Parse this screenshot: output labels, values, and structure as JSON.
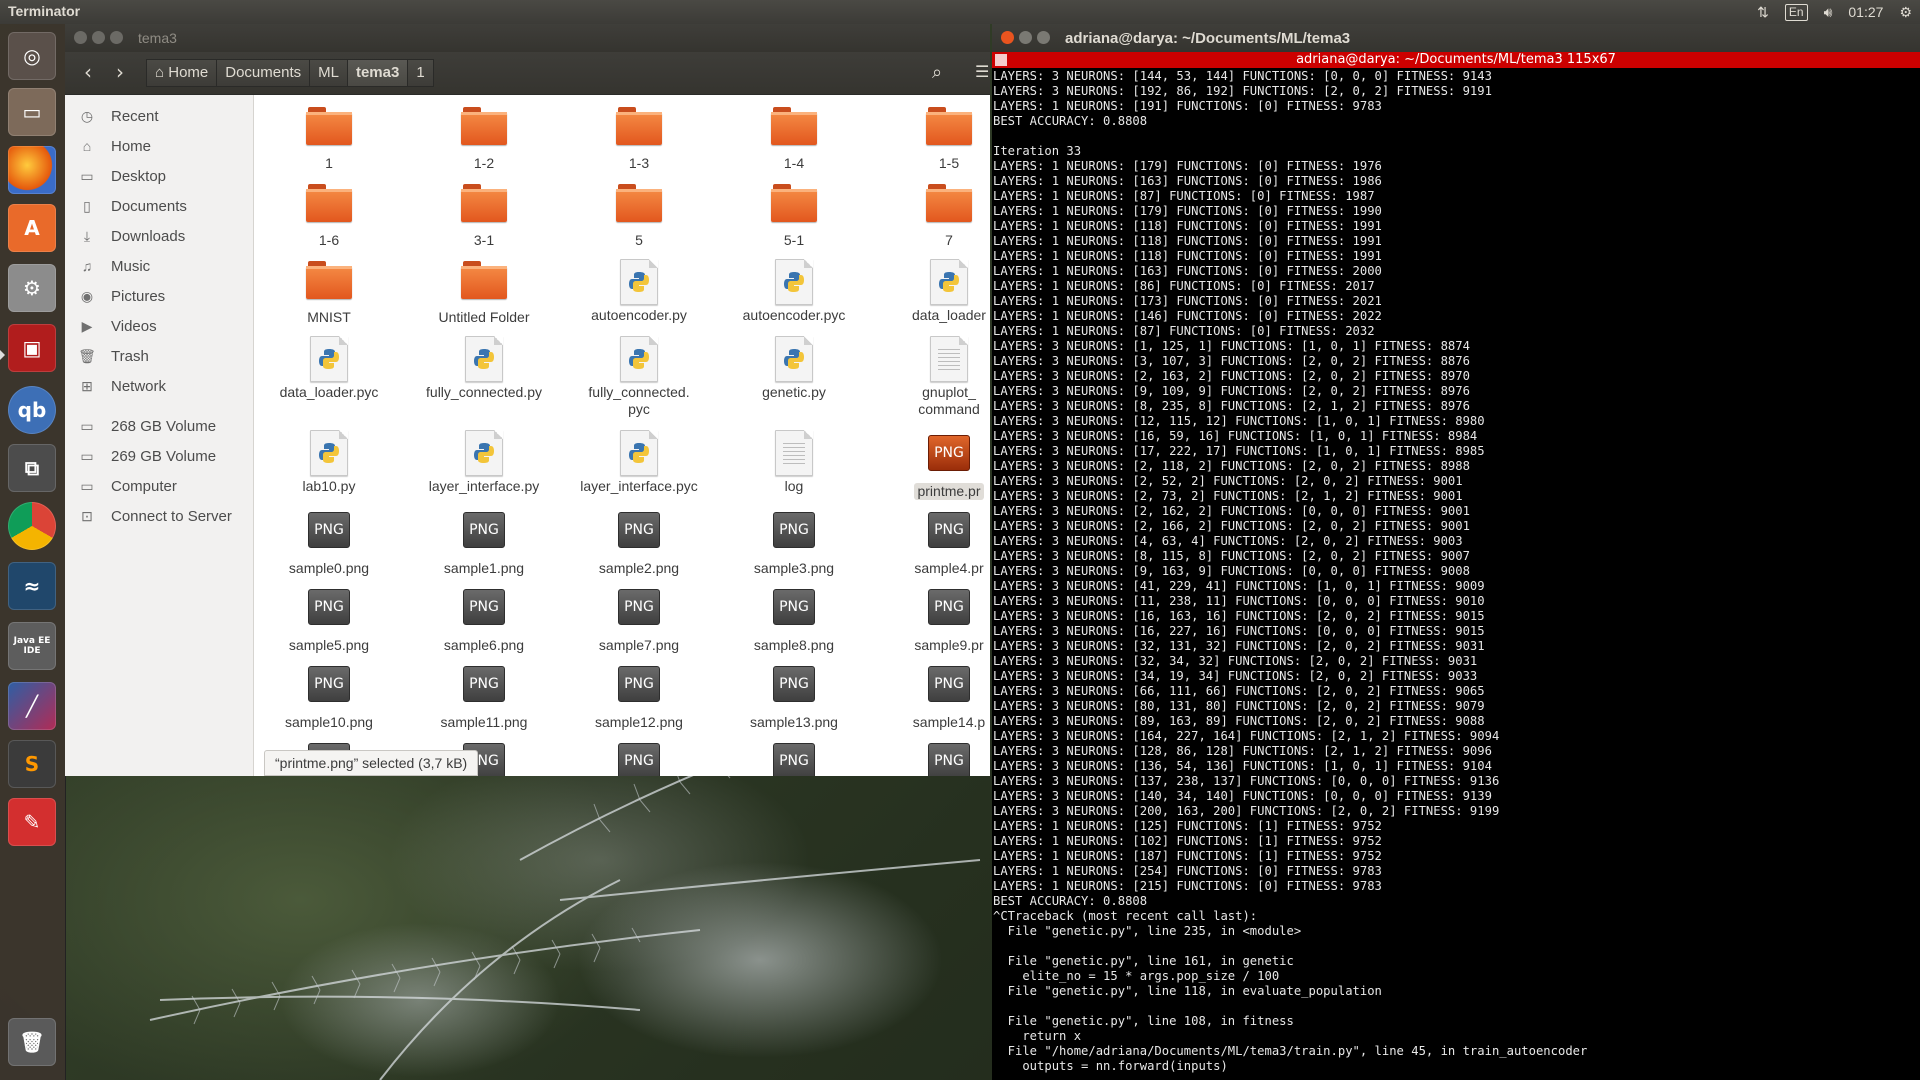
{
  "top_panel": {
    "app_title": "Terminator",
    "keyboard_layout": "En",
    "clock": "01:27",
    "icons": [
      "network-arrows-icon",
      "volume-icon",
      "settings-gear-icon"
    ]
  },
  "launcher": {
    "items": [
      {
        "name": "dash-icon"
      },
      {
        "name": "files-icon"
      },
      {
        "name": "firefox-icon"
      },
      {
        "name": "software-center-icon"
      },
      {
        "name": "system-settings-icon"
      },
      {
        "name": "terminator-icon"
      },
      {
        "name": "qbittorrent-icon",
        "label": "qb"
      },
      {
        "name": "workspace-switcher-icon"
      },
      {
        "name": "chrome-icon"
      },
      {
        "name": "mysql-workbench-icon"
      },
      {
        "name": "java-ee-ide-icon",
        "label": "Java EE IDE"
      },
      {
        "name": "pycharm-icon"
      },
      {
        "name": "sublime-text-icon",
        "label": "S"
      },
      {
        "name": "evince-icon"
      },
      {
        "name": "trash-icon"
      }
    ]
  },
  "file_manager": {
    "window_title": "tema3",
    "breadcrumbs": [
      {
        "label": "Home",
        "icon": "home-icon"
      },
      {
        "label": "Documents"
      },
      {
        "label": "ML"
      },
      {
        "label": "tema3",
        "active": true
      },
      {
        "label": "1"
      }
    ],
    "sidebar": [
      {
        "label": "Recent",
        "icon": "clock-icon"
      },
      {
        "label": "Home",
        "icon": "home-icon"
      },
      {
        "label": "Desktop",
        "icon": "folder-icon"
      },
      {
        "label": "Documents",
        "icon": "document-icon"
      },
      {
        "label": "Downloads",
        "icon": "download-icon"
      },
      {
        "label": "Music",
        "icon": "music-icon"
      },
      {
        "label": "Pictures",
        "icon": "camera-icon"
      },
      {
        "label": "Videos",
        "icon": "video-icon"
      },
      {
        "label": "Trash",
        "icon": "trash-icon"
      },
      {
        "label": "Network",
        "icon": "network-icon"
      },
      {
        "label": "268 GB Volume",
        "icon": "drive-icon"
      },
      {
        "label": "269 GB Volume",
        "icon": "drive-icon"
      },
      {
        "label": "Computer",
        "icon": "computer-icon"
      },
      {
        "label": "Connect to Server",
        "icon": "server-icon"
      }
    ],
    "files": [
      {
        "name": "1",
        "type": "folder"
      },
      {
        "name": "1-2",
        "type": "folder"
      },
      {
        "name": "1-3",
        "type": "folder"
      },
      {
        "name": "1-4",
        "type": "folder"
      },
      {
        "name": "1-5",
        "type": "folder"
      },
      {
        "name": "1-6",
        "type": "folder"
      },
      {
        "name": "3-1",
        "type": "folder"
      },
      {
        "name": "5",
        "type": "folder"
      },
      {
        "name": "5-1",
        "type": "folder"
      },
      {
        "name": "7",
        "type": "folder"
      },
      {
        "name": "MNIST",
        "type": "folder"
      },
      {
        "name": "Untitled Folder",
        "type": "folder"
      },
      {
        "name": "autoencoder.py",
        "type": "python"
      },
      {
        "name": "autoencoder.pyc",
        "type": "python"
      },
      {
        "name": "data_loader",
        "type": "python"
      },
      {
        "name": "data_loader.pyc",
        "type": "python"
      },
      {
        "name": "fully_connected.py",
        "type": "python"
      },
      {
        "name": "fully_connected.",
        "name2": "pyc",
        "type": "python"
      },
      {
        "name": "genetic.py",
        "type": "python"
      },
      {
        "name": "gnuplot_",
        "name2": "command",
        "type": "text"
      },
      {
        "name": "lab10.py",
        "type": "python"
      },
      {
        "name": "layer_interface.py",
        "type": "python"
      },
      {
        "name": "layer_interface.pyc",
        "type": "python"
      },
      {
        "name": "log",
        "type": "text"
      },
      {
        "name": "printme.pr",
        "type": "png",
        "selected": true
      },
      {
        "name": "sample0.png",
        "type": "png"
      },
      {
        "name": "sample1.png",
        "type": "png"
      },
      {
        "name": "sample2.png",
        "type": "png"
      },
      {
        "name": "sample3.png",
        "type": "png"
      },
      {
        "name": "sample4.pr",
        "type": "png"
      },
      {
        "name": "sample5.png",
        "type": "png"
      },
      {
        "name": "sample6.png",
        "type": "png"
      },
      {
        "name": "sample7.png",
        "type": "png"
      },
      {
        "name": "sample8.png",
        "type": "png"
      },
      {
        "name": "sample9.pr",
        "type": "png"
      },
      {
        "name": "sample10.png",
        "type": "png"
      },
      {
        "name": "sample11.png",
        "type": "png"
      },
      {
        "name": "sample12.png",
        "type": "png"
      },
      {
        "name": "sample13.png",
        "type": "png"
      },
      {
        "name": "sample14.p",
        "type": "png"
      },
      {
        "name": "",
        "type": "png"
      },
      {
        "name": "",
        "type": "png"
      },
      {
        "name": "",
        "type": "png"
      },
      {
        "name": "",
        "type": "png"
      },
      {
        "name": "",
        "type": "png"
      }
    ],
    "png_label": "PNG",
    "status": "“printme.png” selected  (3,7 kB)"
  },
  "terminal": {
    "window_title": "adriana@darya: ~/Documents/ML/tema3",
    "bar_title": "adriana@darya: ~/Documents/ML/tema3 115x67",
    "lines": [
      "LAYERS: 3 NEURONS: [144, 53, 144] FUNCTIONS: [0, 0, 0] FITNESS: 9143",
      "LAYERS: 3 NEURONS: [192, 86, 192] FUNCTIONS: [2, 0, 2] FITNESS: 9191",
      "LAYERS: 1 NEURONS: [191] FUNCTIONS: [0] FITNESS: 9783",
      "BEST ACCURACY: 0.8808",
      "",
      "Iteration 33",
      "LAYERS: 1 NEURONS: [179] FUNCTIONS: [0] FITNESS: 1976",
      "LAYERS: 1 NEURONS: [163] FUNCTIONS: [0] FITNESS: 1986",
      "LAYERS: 1 NEURONS: [87] FUNCTIONS: [0] FITNESS: 1987",
      "LAYERS: 1 NEURONS: [179] FUNCTIONS: [0] FITNESS: 1990",
      "LAYERS: 1 NEURONS: [118] FUNCTIONS: [0] FITNESS: 1991",
      "LAYERS: 1 NEURONS: [118] FUNCTIONS: [0] FITNESS: 1991",
      "LAYERS: 1 NEURONS: [118] FUNCTIONS: [0] FITNESS: 1991",
      "LAYERS: 1 NEURONS: [163] FUNCTIONS: [0] FITNESS: 2000",
      "LAYERS: 1 NEURONS: [86] FUNCTIONS: [0] FITNESS: 2017",
      "LAYERS: 1 NEURONS: [173] FUNCTIONS: [0] FITNESS: 2021",
      "LAYERS: 1 NEURONS: [146] FUNCTIONS: [0] FITNESS: 2022",
      "LAYERS: 1 NEURONS: [87] FUNCTIONS: [0] FITNESS: 2032",
      "LAYERS: 3 NEURONS: [1, 125, 1] FUNCTIONS: [1, 0, 1] FITNESS: 8874",
      "LAYERS: 3 NEURONS: [3, 107, 3] FUNCTIONS: [2, 0, 2] FITNESS: 8876",
      "LAYERS: 3 NEURONS: [2, 163, 2] FUNCTIONS: [2, 0, 2] FITNESS: 8970",
      "LAYERS: 3 NEURONS: [9, 109, 9] FUNCTIONS: [2, 0, 2] FITNESS: 8976",
      "LAYERS: 3 NEURONS: [8, 235, 8] FUNCTIONS: [2, 1, 2] FITNESS: 8976",
      "LAYERS: 3 NEURONS: [12, 115, 12] FUNCTIONS: [1, 0, 1] FITNESS: 8980",
      "LAYERS: 3 NEURONS: [16, 59, 16] FUNCTIONS: [1, 0, 1] FITNESS: 8984",
      "LAYERS: 3 NEURONS: [17, 222, 17] FUNCTIONS: [1, 0, 1] FITNESS: 8985",
      "LAYERS: 3 NEURONS: [2, 118, 2] FUNCTIONS: [2, 0, 2] FITNESS: 8988",
      "LAYERS: 3 NEURONS: [2, 52, 2] FUNCTIONS: [2, 0, 2] FITNESS: 9001",
      "LAYERS: 3 NEURONS: [2, 73, 2] FUNCTIONS: [2, 1, 2] FITNESS: 9001",
      "LAYERS: 3 NEURONS: [2, 162, 2] FUNCTIONS: [0, 0, 0] FITNESS: 9001",
      "LAYERS: 3 NEURONS: [2, 166, 2] FUNCTIONS: [2, 0, 2] FITNESS: 9001",
      "LAYERS: 3 NEURONS: [4, 63, 4] FUNCTIONS: [2, 0, 2] FITNESS: 9003",
      "LAYERS: 3 NEURONS: [8, 115, 8] FUNCTIONS: [2, 0, 2] FITNESS: 9007",
      "LAYERS: 3 NEURONS: [9, 163, 9] FUNCTIONS: [0, 0, 0] FITNESS: 9008",
      "LAYERS: 3 NEURONS: [41, 229, 41] FUNCTIONS: [1, 0, 1] FITNESS: 9009",
      "LAYERS: 3 NEURONS: [11, 238, 11] FUNCTIONS: [0, 0, 0] FITNESS: 9010",
      "LAYERS: 3 NEURONS: [16, 163, 16] FUNCTIONS: [2, 0, 2] FITNESS: 9015",
      "LAYERS: 3 NEURONS: [16, 227, 16] FUNCTIONS: [0, 0, 0] FITNESS: 9015",
      "LAYERS: 3 NEURONS: [32, 131, 32] FUNCTIONS: [2, 0, 2] FITNESS: 9031",
      "LAYERS: 3 NEURONS: [32, 34, 32] FUNCTIONS: [2, 0, 2] FITNESS: 9031",
      "LAYERS: 3 NEURONS: [34, 19, 34] FUNCTIONS: [2, 0, 2] FITNESS: 9033",
      "LAYERS: 3 NEURONS: [66, 111, 66] FUNCTIONS: [2, 0, 2] FITNESS: 9065",
      "LAYERS: 3 NEURONS: [80, 131, 80] FUNCTIONS: [2, 0, 2] FITNESS: 9079",
      "LAYERS: 3 NEURONS: [89, 163, 89] FUNCTIONS: [2, 0, 2] FITNESS: 9088",
      "LAYERS: 3 NEURONS: [164, 227, 164] FUNCTIONS: [2, 1, 2] FITNESS: 9094",
      "LAYERS: 3 NEURONS: [128, 86, 128] FUNCTIONS: [2, 1, 2] FITNESS: 9096",
      "LAYERS: 3 NEURONS: [136, 54, 136] FUNCTIONS: [1, 0, 1] FITNESS: 9104",
      "LAYERS: 3 NEURONS: [137, 238, 137] FUNCTIONS: [0, 0, 0] FITNESS: 9136",
      "LAYERS: 3 NEURONS: [140, 34, 140] FUNCTIONS: [0, 0, 0] FITNESS: 9139",
      "LAYERS: 3 NEURONS: [200, 163, 200] FUNCTIONS: [2, 0, 2] FITNESS: 9199",
      "LAYERS: 1 NEURONS: [125] FUNCTIONS: [1] FITNESS: 9752",
      "LAYERS: 1 NEURONS: [102] FUNCTIONS: [1] FITNESS: 9752",
      "LAYERS: 1 NEURONS: [187] FUNCTIONS: [1] FITNESS: 9752",
      "LAYERS: 1 NEURONS: [254] FUNCTIONS: [0] FITNESS: 9783",
      "LAYERS: 1 NEURONS: [215] FUNCTIONS: [0] FITNESS: 9783",
      "BEST ACCURACY: 0.8808",
      "^CTraceback (most recent call last):",
      "  File \"genetic.py\", line 235, in <module>",
      "",
      "  File \"genetic.py\", line 161, in genetic",
      "    elite_no = 15 * args.pop_size / 100",
      "  File \"genetic.py\", line 118, in evaluate_population",
      "",
      "  File \"genetic.py\", line 108, in fitness",
      "    return x",
      "  File \"/home/adriana/Documents/ML/tema3/train.py\", line 45, in train_autoencoder",
      "    outputs = nn.forward(inputs)"
    ]
  }
}
